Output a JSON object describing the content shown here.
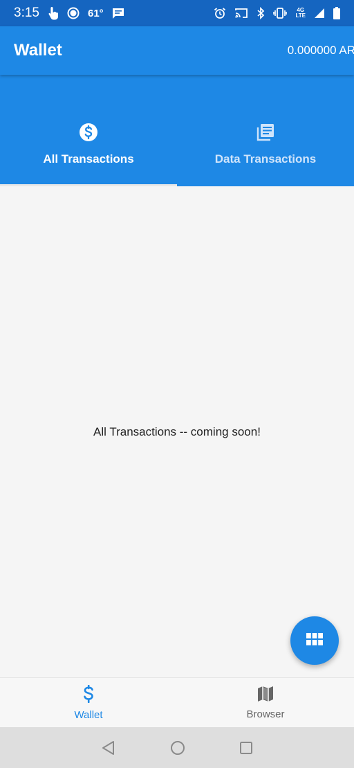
{
  "status_bar": {
    "time": "3:15",
    "temperature": "61°",
    "network_label_top": "4G",
    "network_label_bottom": "LTE"
  },
  "app_bar": {
    "title": "Wallet",
    "balance": "0.000000 AR"
  },
  "tabs": [
    {
      "label": "All Transactions",
      "icon": "dollar-circle-icon",
      "active": true
    },
    {
      "label": "Data Transactions",
      "icon": "library-books-icon",
      "active": false
    }
  ],
  "content": {
    "message": "All Transactions -- coming soon!"
  },
  "fab": {
    "icon": "grid-apps-icon"
  },
  "bottom_nav": [
    {
      "label": "Wallet",
      "icon": "dollar-sign-icon",
      "active": true
    },
    {
      "label": "Browser",
      "icon": "map-icon",
      "active": false
    }
  ],
  "colors": {
    "primary": "#1e88e5",
    "status_bar": "#1565c0",
    "background": "#f5f5f5",
    "inactive_tab_text": "#cfe4fb"
  }
}
